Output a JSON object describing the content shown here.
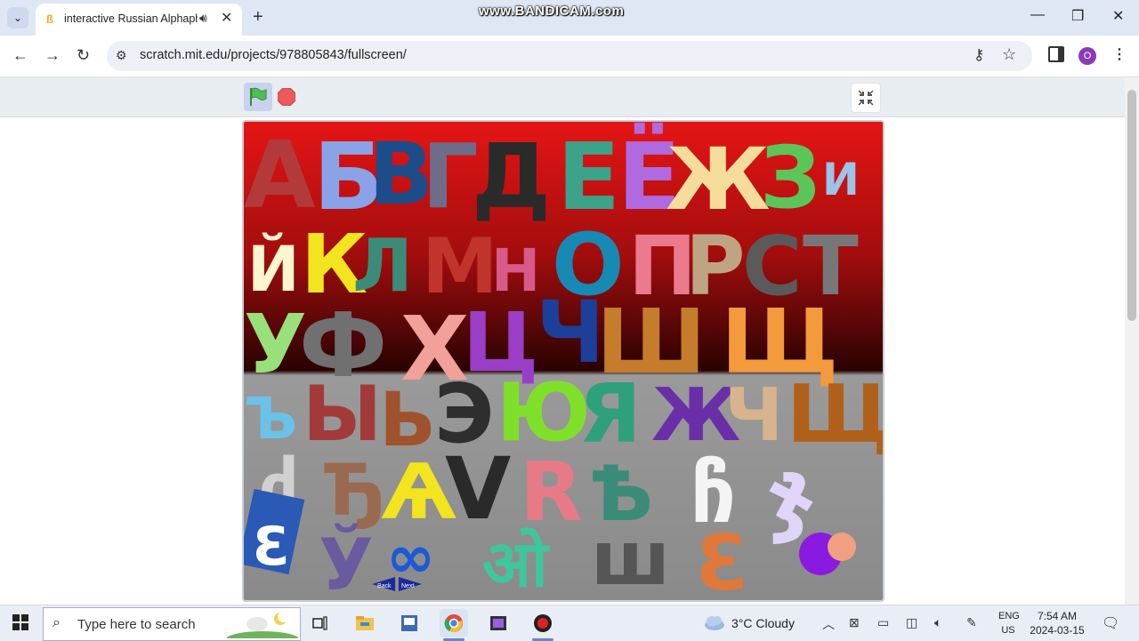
{
  "browser": {
    "tab_title": "interactive Russian Alphaph",
    "favicon": "scratch-cat-icon",
    "new_tab_symbol": "+",
    "url": "scratch.mit.edu/projects/978805843/fullscreen/",
    "profile_initial": "O",
    "watermark": "www.BANDICAM.com"
  },
  "stage": {
    "back_label": "Back",
    "next_label": "Next"
  },
  "taskbar": {
    "search_placeholder": "Type here to search",
    "weather": "3°C  Cloudy",
    "lang_line1": "ENG",
    "lang_line2": "US",
    "time": "7:54 AM",
    "date": "2024-03-15"
  },
  "colors": {
    "tabstrip": "#dfe7f5",
    "stage_top": "#e01010",
    "stage_bottom": "#8e8e8e",
    "scratch_bar": "#e8edf1"
  }
}
